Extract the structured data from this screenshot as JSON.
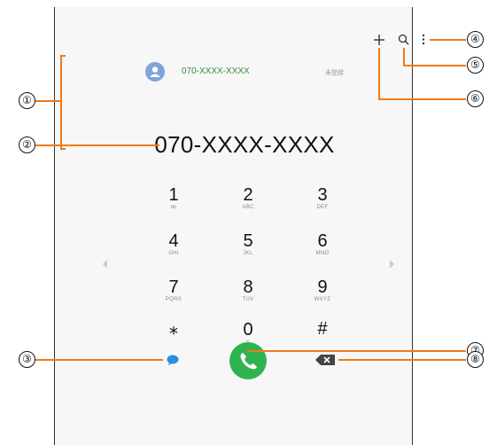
{
  "toolbar": {
    "add_icon": "plus-icon",
    "search_icon": "search-icon",
    "more_icon": "more-vertical-icon"
  },
  "contact_suggestion": {
    "number": "070-XXXX-XXXX",
    "status": "未登録"
  },
  "entered_number": "070-XXXX-XXXX",
  "keypad": [
    {
      "digit": "1",
      "letters": "ꝏ"
    },
    {
      "digit": "2",
      "letters": "ABC"
    },
    {
      "digit": "3",
      "letters": "DEF"
    },
    {
      "digit": "4",
      "letters": "GHI"
    },
    {
      "digit": "5",
      "letters": "JKL"
    },
    {
      "digit": "6",
      "letters": "MNO"
    },
    {
      "digit": "7",
      "letters": "PQRS"
    },
    {
      "digit": "8",
      "letters": "TUV"
    },
    {
      "digit": "9",
      "letters": "WXYZ"
    },
    {
      "digit": "⁎",
      "letters": ""
    },
    {
      "digit": "0",
      "letters": "+"
    },
    {
      "digit": "#",
      "letters": ""
    }
  ],
  "callouts": [
    "①",
    "②",
    "③",
    "④",
    "⑤",
    "⑥",
    "⑦",
    "⑧"
  ],
  "colors": {
    "accent_orange": "#f07a1a",
    "call_green": "#2fb34f",
    "message_blue": "#2a8de0",
    "contact_green": "#3b8a3b"
  }
}
